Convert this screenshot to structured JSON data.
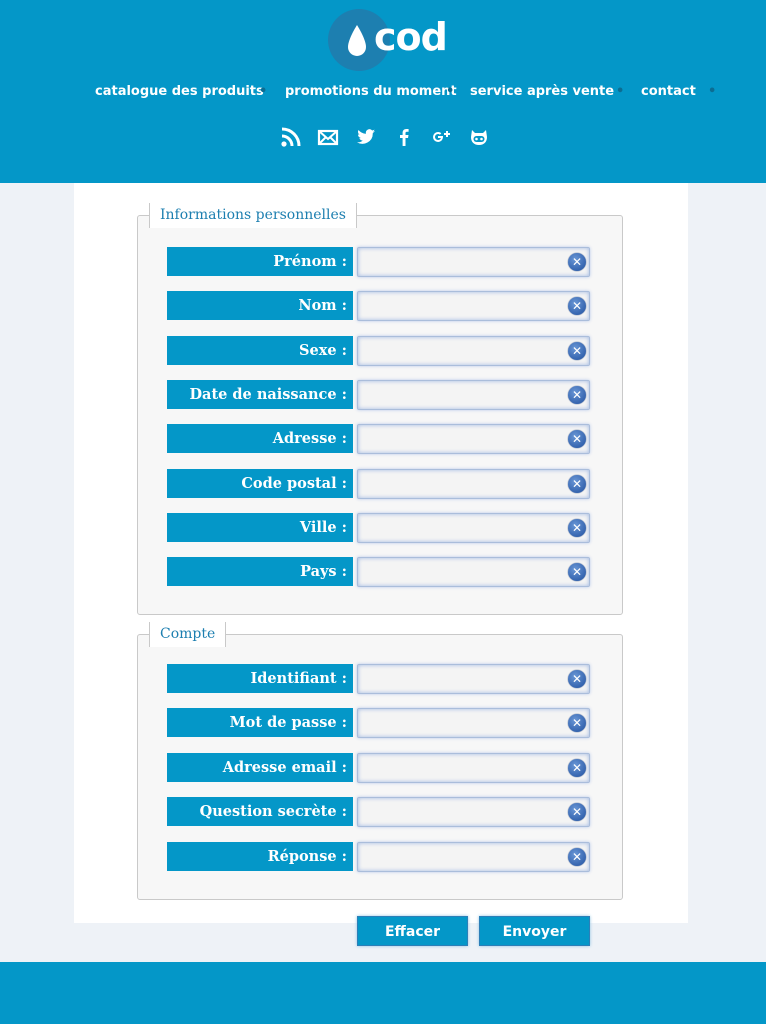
{
  "brand": {
    "logo_text": "cod"
  },
  "nav": {
    "items": [
      {
        "label": "catalogue des produits"
      },
      {
        "label": "promotions du moment"
      },
      {
        "label": "service après vente"
      },
      {
        "label": "contact"
      }
    ]
  },
  "social": [
    "rss-icon",
    "mail-icon",
    "twitter-icon",
    "facebook-icon",
    "google-plus-icon",
    "github-icon"
  ],
  "personal": {
    "legend": "Informations personnelles",
    "fields": [
      {
        "label": "Prénom :",
        "value": ""
      },
      {
        "label": "Nom :",
        "value": ""
      },
      {
        "label": "Sexe :",
        "value": ""
      },
      {
        "label": "Date de naissance :",
        "value": ""
      },
      {
        "label": "Adresse :",
        "value": ""
      },
      {
        "label": "Code postal :",
        "value": ""
      },
      {
        "label": "Ville :",
        "value": ""
      },
      {
        "label": "Pays :",
        "value": ""
      }
    ]
  },
  "account": {
    "legend": "Compte",
    "fields": [
      {
        "label": "Identifiant :",
        "value": ""
      },
      {
        "label": "Mot de passe :",
        "value": ""
      },
      {
        "label": "Adresse email :",
        "value": ""
      },
      {
        "label": "Question secrète :",
        "value": ""
      },
      {
        "label": "Réponse :",
        "value": ""
      }
    ]
  },
  "actions": {
    "reset_label": "Effacer",
    "submit_label": "Envoyer"
  },
  "colors": {
    "primary": "#0497c8",
    "legend_text": "#1d7fb0",
    "clear_icon": "#2a5ba8"
  }
}
